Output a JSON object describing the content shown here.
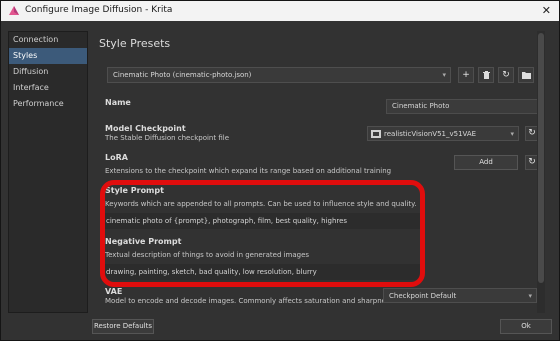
{
  "window": {
    "title": "Configure Image Diffusion - Krita"
  },
  "sidebar": {
    "items": [
      {
        "label": "Connection"
      },
      {
        "label": "Styles"
      },
      {
        "label": "Diffusion"
      },
      {
        "label": "Interface"
      },
      {
        "label": "Performance"
      }
    ],
    "active_index": 1
  },
  "page": {
    "title": "Style Presets"
  },
  "preset": {
    "selected": "Cinematic Photo (cinematic-photo.json)"
  },
  "name": {
    "label": "Name",
    "value": "Cinematic Photo"
  },
  "checkpoint": {
    "label": "Model Checkpoint",
    "description": "The Stable Diffusion checkpoint file",
    "value": "realisticVisionV51_v51VAE"
  },
  "lora": {
    "label": "LoRA",
    "description": "Extensions to the checkpoint which expand its range based on additional training",
    "add_label": "Add"
  },
  "style_prompt": {
    "label": "Style Prompt",
    "description": "Keywords which are appended to all prompts. Can be used to influence style and quality.",
    "value": "cinematic photo of {prompt}, photograph, film, best quality, highres"
  },
  "negative_prompt": {
    "label": "Negative Prompt",
    "description": "Textual description of things to avoid in generated images",
    "value": "drawing, painting, sketch, bad quality, low resolution, blurry"
  },
  "vae": {
    "label": "VAE",
    "description": "Model to encode and decode images. Commonly affects saturation and sharpne",
    "value": "Checkpoint Default"
  },
  "footer": {
    "restore_label": "Restore Defaults",
    "ok_label": "Ok"
  },
  "colors": {
    "highlight": "#e00d0d",
    "active_nav": "#3c5a7a"
  }
}
